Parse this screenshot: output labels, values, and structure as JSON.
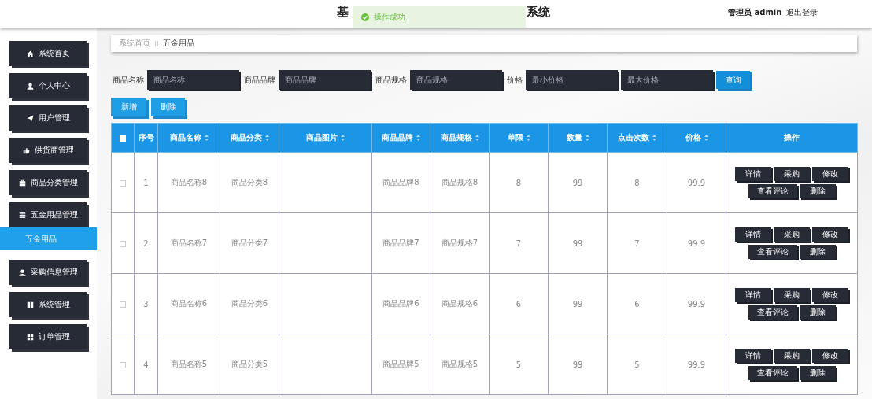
{
  "header": {
    "title_start": "基",
    "title_end": "系统",
    "user": "管理员 admin",
    "logout": "退出登录"
  },
  "toast": {
    "text": "操作成功",
    "kind": "success"
  },
  "sidebar": {
    "items": [
      {
        "label": "系统首页",
        "selected": false
      },
      {
        "label": "个人中心",
        "selected": false
      },
      {
        "label": "用户管理",
        "selected": false
      },
      {
        "label": "供货商管理",
        "selected": false
      },
      {
        "label": "商品分类管理",
        "selected": false
      },
      {
        "label": "五金用品管理",
        "selected": false,
        "children": [
          {
            "label": "五金用品",
            "selected": true
          }
        ]
      },
      {
        "label": "采购信息管理",
        "selected": false
      },
      {
        "label": "系统管理",
        "selected": false
      },
      {
        "label": "订单管理",
        "selected": false
      }
    ]
  },
  "breadcrumb": {
    "items": [
      "系统首页",
      "五金用品"
    ]
  },
  "search": {
    "fields": [
      {
        "label": "商品名称",
        "placeholder": "商品名称"
      },
      {
        "label": "商品品牌",
        "placeholder": "商品品牌"
      },
      {
        "label": "商品规格",
        "placeholder": "商品规格"
      },
      {
        "label": "价格",
        "placeholder": "最小价格"
      },
      {
        "placeholder": "最大价格"
      }
    ],
    "button": "查询"
  },
  "actions": [
    "新增",
    "删除"
  ],
  "table": {
    "all_checked": false,
    "columns": [
      {
        "label": "序号",
        "sortable": false
      },
      {
        "label": "商品名称",
        "sortable": true
      },
      {
        "label": "商品分类",
        "sortable": true
      },
      {
        "label": "商品图片",
        "sortable": true
      },
      {
        "label": "商品品牌",
        "sortable": true
      },
      {
        "label": "商品规格",
        "sortable": true
      },
      {
        "label": "单限",
        "sortable": true
      },
      {
        "label": "数量",
        "sortable": true
      },
      {
        "label": "点击次数",
        "sortable": true
      },
      {
        "label": "价格",
        "sortable": true
      },
      {
        "label": "操作",
        "sortable": false
      }
    ],
    "rows": [
      {
        "checked": false,
        "cells": [
          "1",
          "商品名称8",
          "商品分类8",
          "",
          "商品品牌8",
          "商品规格8",
          "8",
          "99",
          "8",
          "99.9"
        ],
        "buttons": [
          "详情",
          "采购",
          "修改",
          "查看评论",
          "删除"
        ]
      },
      {
        "checked": false,
        "cells": [
          "2",
          "商品名称7",
          "商品分类7",
          "",
          "商品品牌7",
          "商品规格7",
          "7",
          "99",
          "7",
          "99.9"
        ],
        "buttons": [
          "详情",
          "采购",
          "修改",
          "查看评论",
          "删除"
        ]
      },
      {
        "checked": false,
        "cells": [
          "3",
          "商品名称6",
          "商品分类6",
          "",
          "商品品牌6",
          "商品规格6",
          "6",
          "99",
          "6",
          "99.9"
        ],
        "buttons": [
          "详情",
          "采购",
          "修改",
          "查看评论",
          "删除"
        ]
      },
      {
        "checked": false,
        "cells": [
          "4",
          "商品名称5",
          "商品分类5",
          "",
          "商品品牌5",
          "商品规格5",
          "5",
          "99",
          "5",
          "99.9"
        ],
        "buttons": [
          "详情",
          "采购",
          "修改",
          "查看评论",
          "删除"
        ]
      }
    ]
  }
}
